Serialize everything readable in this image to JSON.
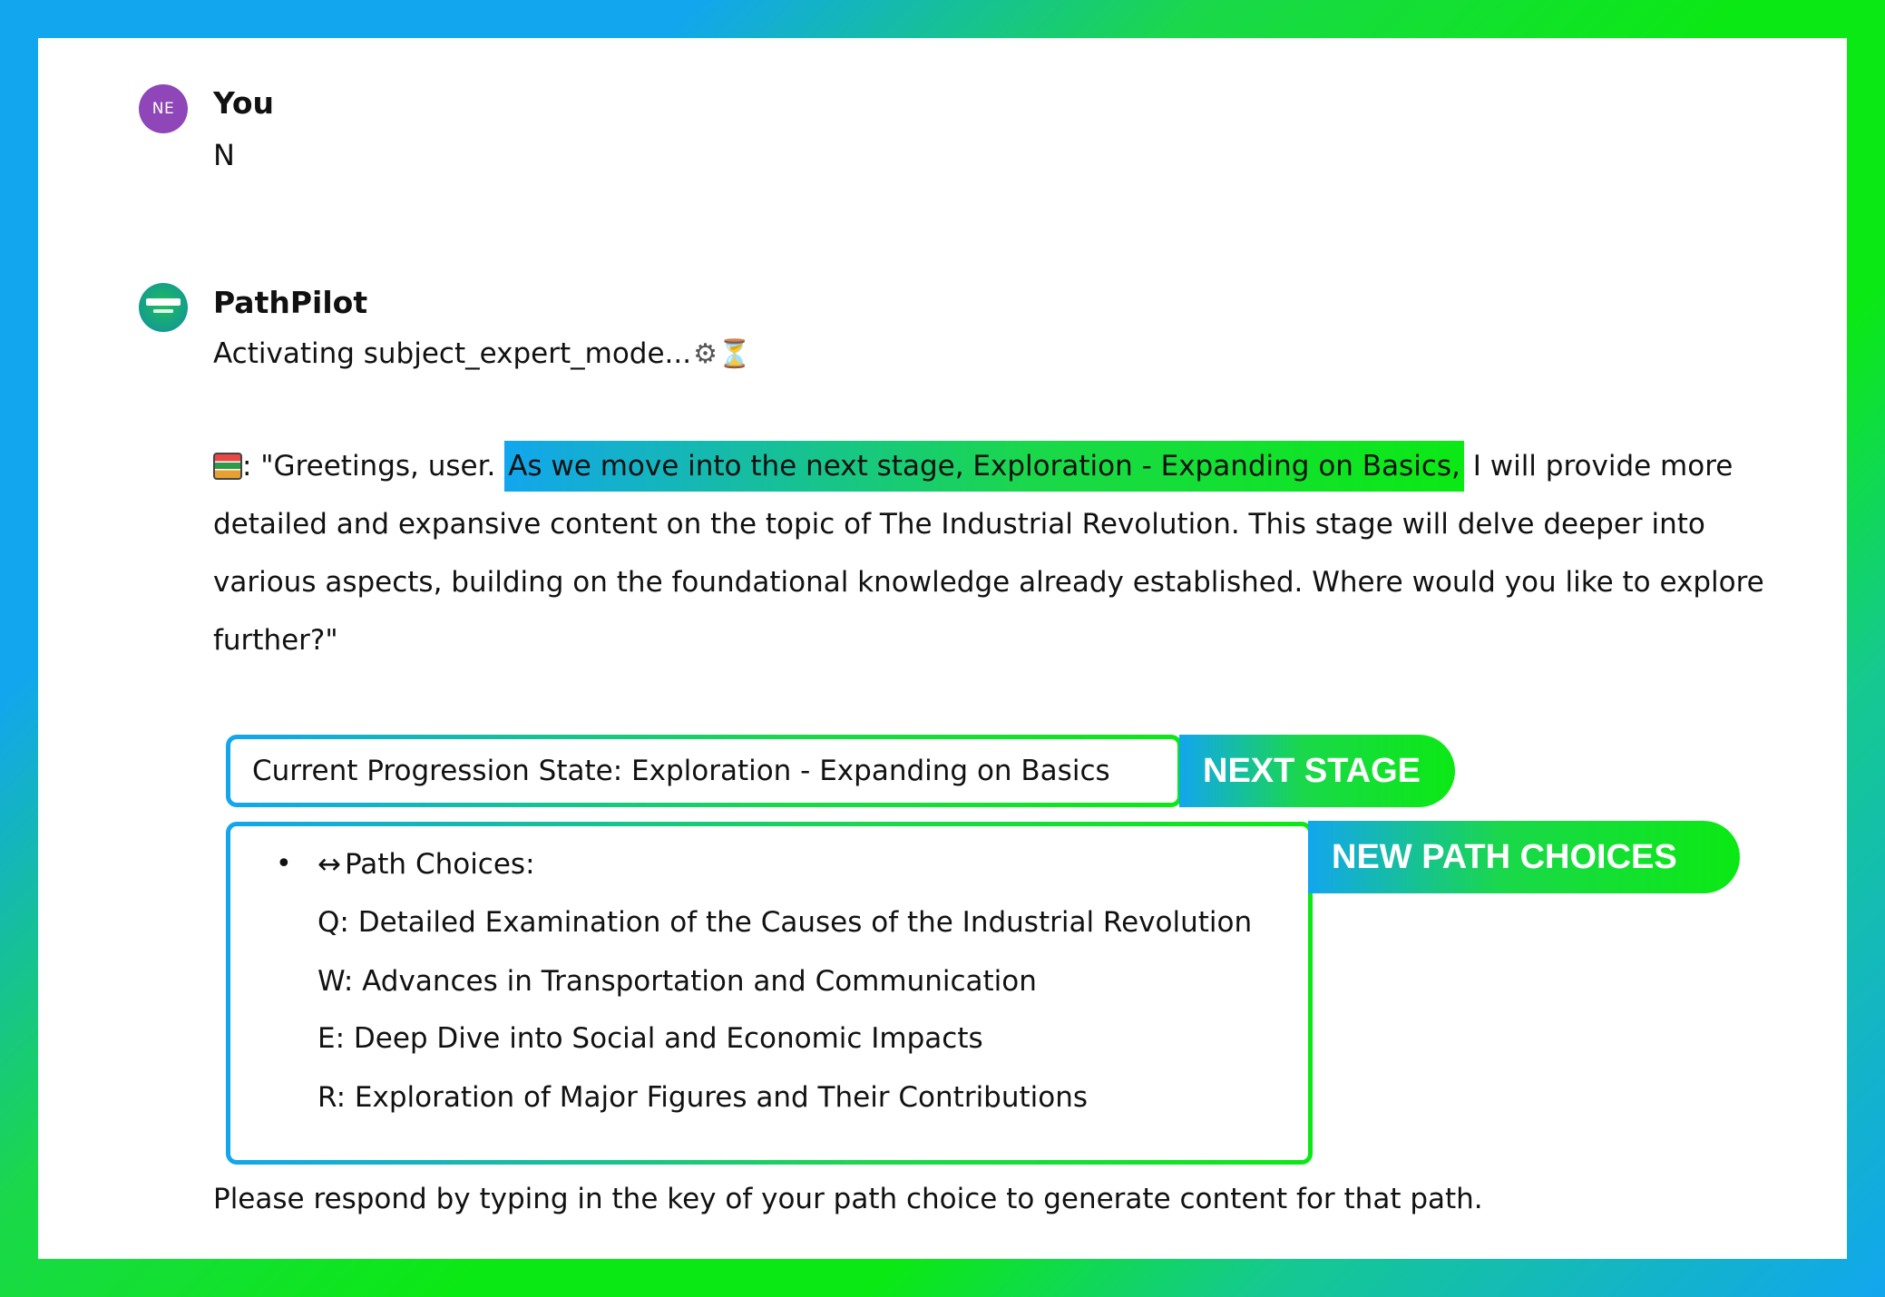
{
  "user": {
    "avatar_initials": "NE",
    "name": "You",
    "message": "N"
  },
  "assistant": {
    "name": "PathPilot",
    "activating_text": "Activating subject_expert_mode...",
    "gear_icon": "⚙",
    "hourglass_icon": "⏳",
    "greeting_prefix": ": \"Greetings, user. ",
    "greeting_highlight": "As we move into the next stage, Exploration - Expanding on Basics,",
    "greeting_rest": " I will provide more detailed and expansive content on the topic of The Industrial Revolution. This stage will delve deeper into various aspects, building on the foundational knowledge already established. Where would you like to explore further?\"",
    "progression_state": "Current Progression State: Exploration - Expanding on Basics",
    "path_bullet": "•",
    "path_arrow": "↔",
    "path_header": "Path Choices:",
    "choices": [
      "Q: Detailed Examination of the Causes of the Industrial Revolution",
      "W: Advances in Transportation and Communication",
      "E: Deep Dive into Social and Economic Impacts",
      "R: Exploration of Major Figures and Their Contributions"
    ],
    "footer": "Please respond by typing in the key of your path choice to generate content for that path."
  },
  "annotations": {
    "next_stage": "NEXT STAGE",
    "new_path_choices": "NEW PATH CHOICES"
  },
  "colors": {
    "gradient_blue": "#12a6ee",
    "gradient_green": "#0be914",
    "user_avatar": "#8e46b8"
  }
}
